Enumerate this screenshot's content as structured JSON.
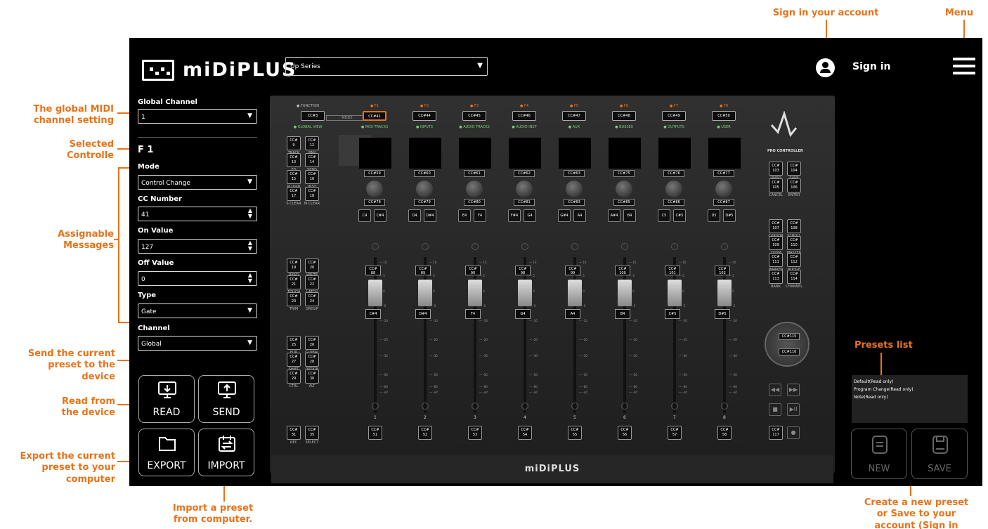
{
  "app": {
    "logo_text": "miDiPLUS",
    "series_value": "Up Series",
    "sign_in": "Sign in",
    "bottom_brand": "miDiPLUS"
  },
  "left_panel": {
    "global_channel_label": "Global Channel",
    "global_channel_value": "1",
    "selected_control": "F 1",
    "mode_label": "Mode",
    "mode_value": "Control Change",
    "cc_number_label": "CC Number",
    "cc_number_value": "41",
    "on_value_label": "On Value",
    "on_value_value": "127",
    "off_value_label": "Off Value",
    "off_value_value": "0",
    "type_label": "Type",
    "type_value": "Gate",
    "channel_label": "Channel",
    "channel_value": "Global"
  },
  "buttons": {
    "read": "READ",
    "send": "SEND",
    "export": "EXPORT",
    "import": "IMPORT",
    "new": "NEW",
    "save": "SAVE"
  },
  "annotations": {
    "sign_in": "Sign in your account",
    "menu": "Menu",
    "global_midi": "The global MIDI channel setting",
    "selected": "Selected Controlle",
    "assignable": "Assignable Messages",
    "send": "Send the current preset to the device",
    "read": "Read from the device",
    "export": "Export the current preset to your computer",
    "import": "Import a preset from computer.",
    "presets": "Presets list",
    "create": "Create a new preset or Save to your account (Sign in request)"
  },
  "presets": [
    "Default(Read only)",
    "Program Change(Read only)",
    "Note(Read only)"
  ],
  "controller": {
    "function_label": "FUNCTION",
    "function_key": "CC#3",
    "mode_tag": "MODE",
    "global_view": "GLOBAL VIEW",
    "f_keys": [
      {
        "label": "F1",
        "cc": "CC#41",
        "name": "MIDI TRACKS"
      },
      {
        "label": "F2",
        "cc": "CC#44",
        "name": "INPUTS"
      },
      {
        "label": "F3",
        "cc": "CC#45",
        "name": "AUDIO TRACKS"
      },
      {
        "label": "F4",
        "cc": "CC#46",
        "name": "AUDIO INST"
      },
      {
        "label": "F5",
        "cc": "CC#47",
        "name": "AUX"
      },
      {
        "label": "F6",
        "cc": "CC#48",
        "name": "BUSSES"
      },
      {
        "label": "F7",
        "cc": "CC#49",
        "name": "OUTPUTS"
      },
      {
        "label": "F8",
        "cc": "CC#50",
        "name": "USER"
      }
    ],
    "knob_top": [
      "CC#59",
      "CC#60",
      "CC#61",
      "CC#62",
      "CC#63",
      "CC#75",
      "CC#76",
      "CC#77"
    ],
    "knob_bottom": [
      "CC#78",
      "CC#79",
      "CC#80",
      "CC#81",
      "CC#83",
      "CC#85",
      "CC#86",
      "CC#87"
    ],
    "note_keys": [
      [
        "C4",
        "C#4"
      ],
      [
        "D4",
        "D#4"
      ],
      [
        "E4",
        "F4"
      ],
      [
        "F#4",
        "G4"
      ],
      [
        "G#4",
        "A4"
      ],
      [
        "A#4",
        "B4"
      ],
      [
        "C5",
        "C#5"
      ],
      [
        "D5",
        "D#5"
      ]
    ],
    "fader_cc": [
      [
        "CC#",
        "88"
      ],
      [
        "CC#",
        "89"
      ],
      [
        "CC#",
        "90"
      ],
      [
        "CC#",
        "98"
      ],
      [
        "CC#",
        "99"
      ],
      [
        "CC#",
        "100"
      ],
      [
        "CC#",
        "101"
      ],
      [
        "CC#",
        "102"
      ]
    ],
    "fader_note": [
      "C#4",
      "D#4",
      "F4",
      "G4",
      "A4",
      "B4",
      "C#5",
      "D#5"
    ],
    "channel_numbers": [
      "1",
      "2",
      "3",
      "4",
      "5",
      "6",
      "7",
      "8"
    ],
    "channel_keys": [
      "51",
      "52",
      "53",
      "54",
      "55",
      "56",
      "57",
      "58"
    ],
    "scale": [
      "10",
      "5",
      "0",
      "-5",
      "-10",
      "-20",
      "-30",
      "-50",
      "-60",
      "-inf"
    ],
    "left_top_keys": [
      [
        "9",
        "12"
      ],
      [
        "13",
        "14"
      ],
      [
        "15",
        "16"
      ],
      [
        "17",
        "18"
      ]
    ],
    "left_top_labels": [
      [
        "TRACK",
        "PAN"
      ],
      [
        "EQ",
        "SEND"
      ],
      [
        "PLUGIN",
        "INST"
      ],
      [
        "S CLEAR",
        "M CLEAR"
      ]
    ],
    "left_mid_keys": [
      [
        "19",
        "20"
      ],
      [
        "21",
        "22"
      ],
      [
        "23",
        "24"
      ]
    ],
    "left_mid_labels": [
      [
        "READ",
        "WRITE"
      ],
      [
        "TOUCH",
        "LATCH"
      ],
      [
        "TRIM",
        "GROUP"
      ]
    ],
    "left_low_keys": [
      [
        "25",
        "26"
      ],
      [
        "27",
        "28"
      ],
      [
        "29",
        "30"
      ]
    ],
    "left_low_labels": [
      [
        "FLIP",
        "GLOBAL"
      ],
      [
        "SHIFT",
        "OPTION"
      ],
      [
        "CTRL",
        "ALT"
      ]
    ],
    "left_bottom_keys": [
      "31",
      "35"
    ],
    "left_bottom_labels": [
      "REC",
      "SELECT"
    ],
    "key_prefix": "CC#",
    "pro_label": "PRO CONTROLLER",
    "right_top_keys": [
      [
        "103",
        "104"
      ],
      [
        "105",
        "106"
      ]
    ],
    "right_top_labels": [
      [
        "UNDO",
        "SAVE"
      ],
      [
        "CANCEL",
        "ENTER"
      ]
    ],
    "right_mid_keys": [
      [
        "107",
        "108"
      ],
      [
        "109",
        "110"
      ],
      [
        "111",
        "112"
      ],
      [
        "113",
        "114"
      ]
    ],
    "right_mid_labels": [
      [
        "CURSOR",
        "SCROLL"
      ],
      [
        "ZOOM",
        "MASTER"
      ],
      [
        "MARKER",
        "NUDGE"
      ],
      [
        "BANK",
        "CHANNEL"
      ]
    ],
    "wheel_keys": [
      "CC#115",
      "CC#116"
    ],
    "right_bottom_key": "117"
  }
}
